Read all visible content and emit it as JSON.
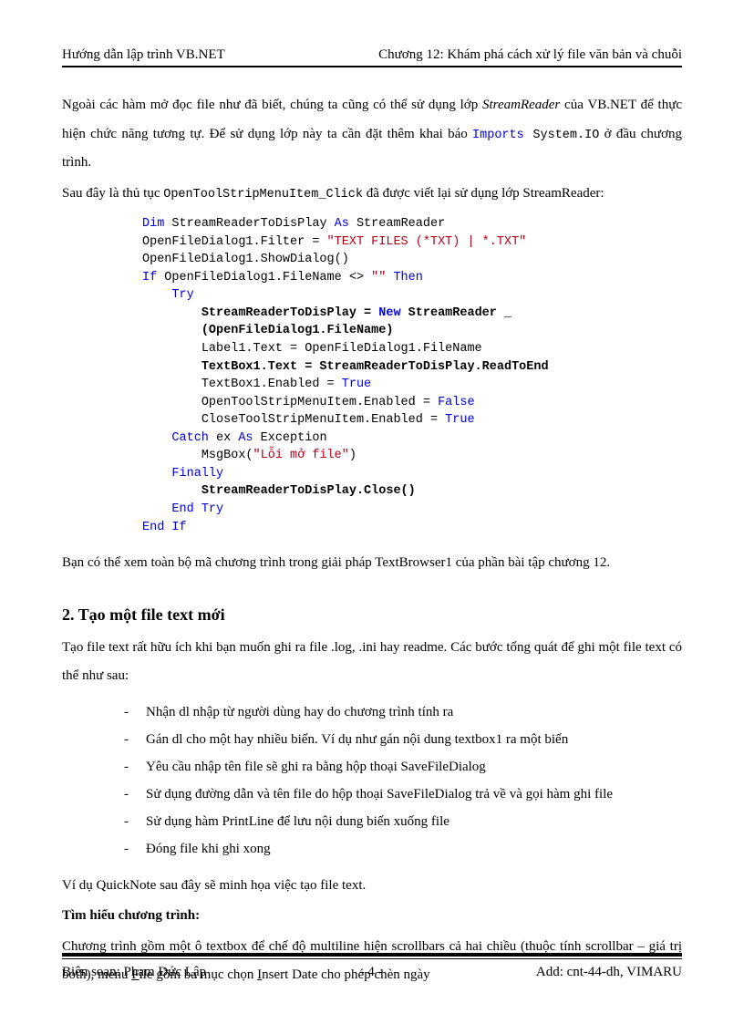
{
  "header": {
    "left": "Hướng dẫn lập trình VB.NET",
    "right": "Chương 12: Khám phá cách xử lý file văn bản và chuỗi"
  },
  "p1_a": "Ngoài các hàm mở đọc file như đã biết, chúng ta cũng có thể sử dụng lớp ",
  "p1_sr": "StreamReader",
  "p1_b": " của VB.NET để thực hiện chức năng tương tự. Để sử dụng lớp này ta cần đặt thêm khai báo ",
  "p1_imp": "Imports",
  "p1_sys": " System.IO",
  "p1_c": " ở đầu chương trình.",
  "p2_a": "Sau đây là thủ tục ",
  "p2_fn": "OpenToolStripMenuItem_Click",
  "p2_b": " đã được viết lại sử dụng lớp StreamReader:",
  "code": {
    "l1a": "Dim",
    "l1b": " StreamReaderToDisPlay ",
    "l1c": "As",
    "l1d": " StreamReader",
    "l2a": "OpenFileDialog1.Filter = ",
    "l2b": "\"TEXT FILES (*TXT) | *.TXT\"",
    "l3": "OpenFileDialog1.ShowDialog()",
    "l4a": "If",
    "l4b": " OpenFileDialog1.FileName <> ",
    "l4c": "\"\"",
    "l4d": " Then",
    "l5": "Try",
    "l6a": "StreamReaderToDisPlay = ",
    "l6b": "New",
    "l6c": " StreamReader _",
    "l7": "(OpenFileDialog1.FileName)",
    "l8": "Label1.Text = OpenFileDialog1.FileName",
    "l9": "TextBox1.Text = StreamReaderToDisPlay.ReadToEnd",
    "l10a": "TextBox1.Enabled = ",
    "l10b": "True",
    "l11a": "OpenToolStripMenuItem.Enabled = ",
    "l11b": "False",
    "l12a": "CloseToolStripMenuItem.Enabled = ",
    "l12b": "True",
    "l13a": "Catch",
    "l13b": " ex ",
    "l13c": "As",
    "l13d": " Exception",
    "l14a": "MsgBox(",
    "l14b": "\"Lỗi mở file\"",
    "l14c": ")",
    "l15": "Finally",
    "l16": "StreamReaderToDisPlay.Close()",
    "l17a": "End",
    "l17b": " Try",
    "l18a": "End",
    "l18b": " If"
  },
  "p3": "Bạn có thể xem toàn bộ mã chương trình trong giải pháp TextBrowser1 của phần bài tập chương 12.",
  "h2": "2. Tạo một file text mới",
  "p4": "Tạo file text rất hữu ích khi bạn muốn ghi ra file .log, .ini hay readme. Các bước tổng quát để ghi một file text có thể như sau:",
  "bullets": [
    "Nhận dl nhập từ người dùng hay do chương trình tính ra",
    "Gán dl cho một hay nhiều biến. Ví dụ như gán nội dung textbox1 ra một biến",
    "Yêu cầu nhập tên file sẽ ghi ra bằng hộp thoại SaveFileDialog",
    "Sử dụng đường dẫn và tên file do hộp thoại SaveFileDialog trả về và gọi hàm ghi file",
    "Sử dụng hàm PrintLine để lưu nội dung biến xuống file",
    "Đóng file khi ghi xong"
  ],
  "p5": "Ví dụ QuickNote sau đây sẽ minh họa việc tạo file text.",
  "p6": "Tìm hiểu chương trình:",
  "p7_a": "Chương trình gồm một ô textbox để chế độ multiline hiện scrollbars cả hai chiều (thuộc tính scrollbar – giá trị both), menu ",
  "p7_file_f": "F",
  "p7_file_rest": "ile",
  "p7_b": " gồm ba mục chọn ",
  "p7_ins_i": "I",
  "p7_ins_rest": "nsert Date",
  "p7_c": " cho phép chèn ngày",
  "footer": {
    "left": "Biên soạn: Phạm Đức Lập",
    "center": "- 4 -",
    "right": "Add: cnt-44-dh, VIMARU"
  }
}
